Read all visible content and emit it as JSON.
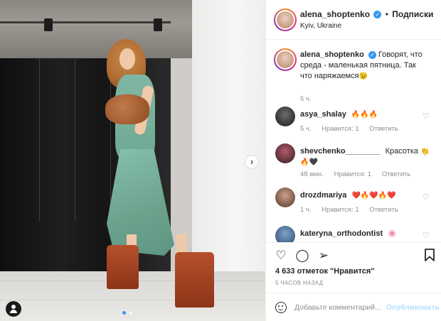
{
  "post": {
    "username": "alena_shoptenko",
    "follow_separator": "•",
    "follow_label": "Подписки",
    "location": "Kyiv, Ukraine",
    "caption": "Говорят, что среда - маленькая пятница. Так что наряжаемся",
    "caption_emoji": "😉",
    "caption_time": "5 ч."
  },
  "comments": [
    {
      "username": "asya_shalay",
      "text": "",
      "emoji": "🔥🔥🔥",
      "time": "5 ч.",
      "likes": "Нравится: 1",
      "reply": "Ответить"
    },
    {
      "username": "shevchenko________",
      "text": "Красотка",
      "emoji": "👏",
      "emoji2": "🔥🖤",
      "time": "48 мин.",
      "likes": "Нравится: 1",
      "reply": "Ответить"
    },
    {
      "username": "drozdmariya",
      "text": "",
      "emoji": "❤️🔥❤️🔥❤️",
      "time": "1 ч.",
      "likes": "Нравится: 1",
      "reply": "Ответить"
    },
    {
      "username": "kateryna_orthodontist",
      "text": "",
      "emoji": "🌸"
    }
  ],
  "actions": {
    "likes_count": "4 633 отметок \"Нравится\"",
    "time_ago": "5 ЧАСОВ НАЗАД"
  },
  "add_comment": {
    "placeholder": "Добавьте комментарий...",
    "publish_label": "Опубликовать"
  },
  "icons": {
    "like": "heart-icon",
    "comment": "comment-icon",
    "share": "share-icon",
    "save": "bookmark-icon",
    "next": "chevron-right-icon",
    "tag": "user-tag-icon",
    "emoji": "emoji-icon"
  },
  "colors": {
    "verified": "#3897f0",
    "publish": "#b2dffc",
    "muted": "#8e8e8e"
  }
}
